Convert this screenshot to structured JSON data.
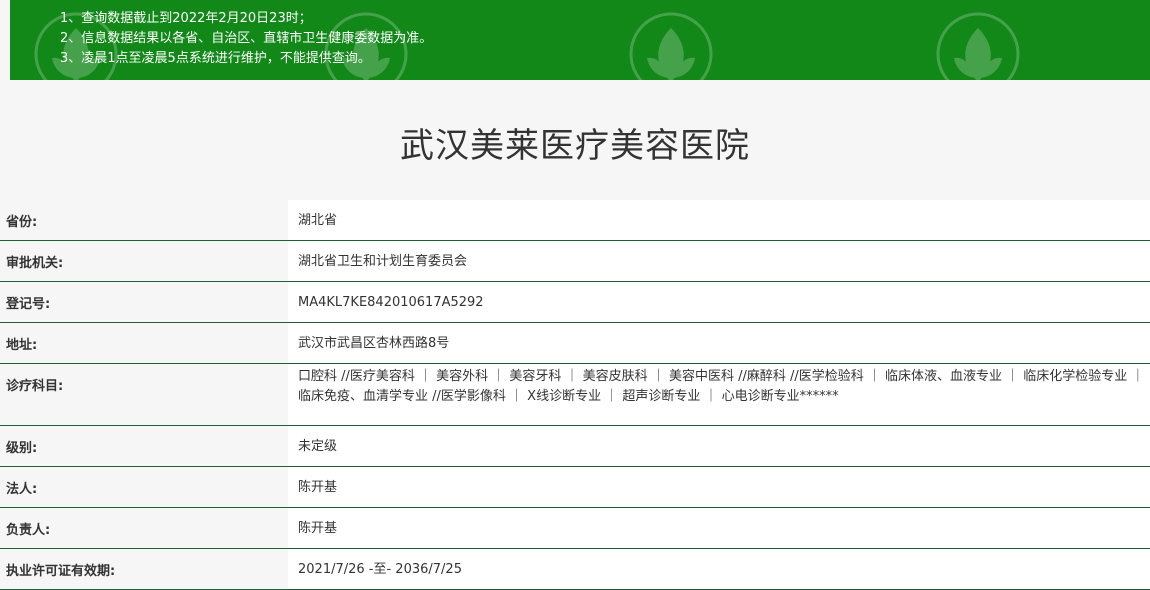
{
  "notice": {
    "lines": [
      "1、查询数据截止到2022年2月20日23时；",
      "2、信息数据结果以各省、自治区、直辖市卫生健康委数据为准。",
      "3、凌晨1点至凌晨5点系统进行维护，不能提供查询。"
    ]
  },
  "title": "武汉美莱医疗美容医院",
  "fields": [
    {
      "label": "省份:",
      "value": "湖北省"
    },
    {
      "label": "审批机关:",
      "value": "湖北省卫生和计划生育委员会"
    },
    {
      "label": "登记号:",
      "value": "MA4KL7KE842010617A5292"
    },
    {
      "label": "地址:",
      "value": "武汉市武昌区杏林西路8号"
    },
    {
      "label": "诊疗科目:",
      "value": "口腔科 //医疗美容科 ｜ 美容外科 ｜ 美容牙科 ｜ 美容皮肤科 ｜ 美容中医科 //麻醉科 //医学检验科 ｜ 临床体液、血液专业 ｜ 临床化学检验专业 ｜ 临床免疫、血清学专业 //医学影像科 ｜ X线诊断专业 ｜ 超声诊断专业 ｜ 心电诊断专业******"
    },
    {
      "label": "级别:",
      "value": "未定级"
    },
    {
      "label": "法人:",
      "value": "陈开基"
    },
    {
      "label": "负责人:",
      "value": "陈开基"
    },
    {
      "label": "执业许可证有效期:",
      "value": "2021/7/26 -至- 2036/7/25"
    }
  ],
  "colors": {
    "banner": "#118818",
    "row_border": "#1f5f36"
  },
  "icons": {
    "watermark": "leaf-emblem-icon"
  }
}
